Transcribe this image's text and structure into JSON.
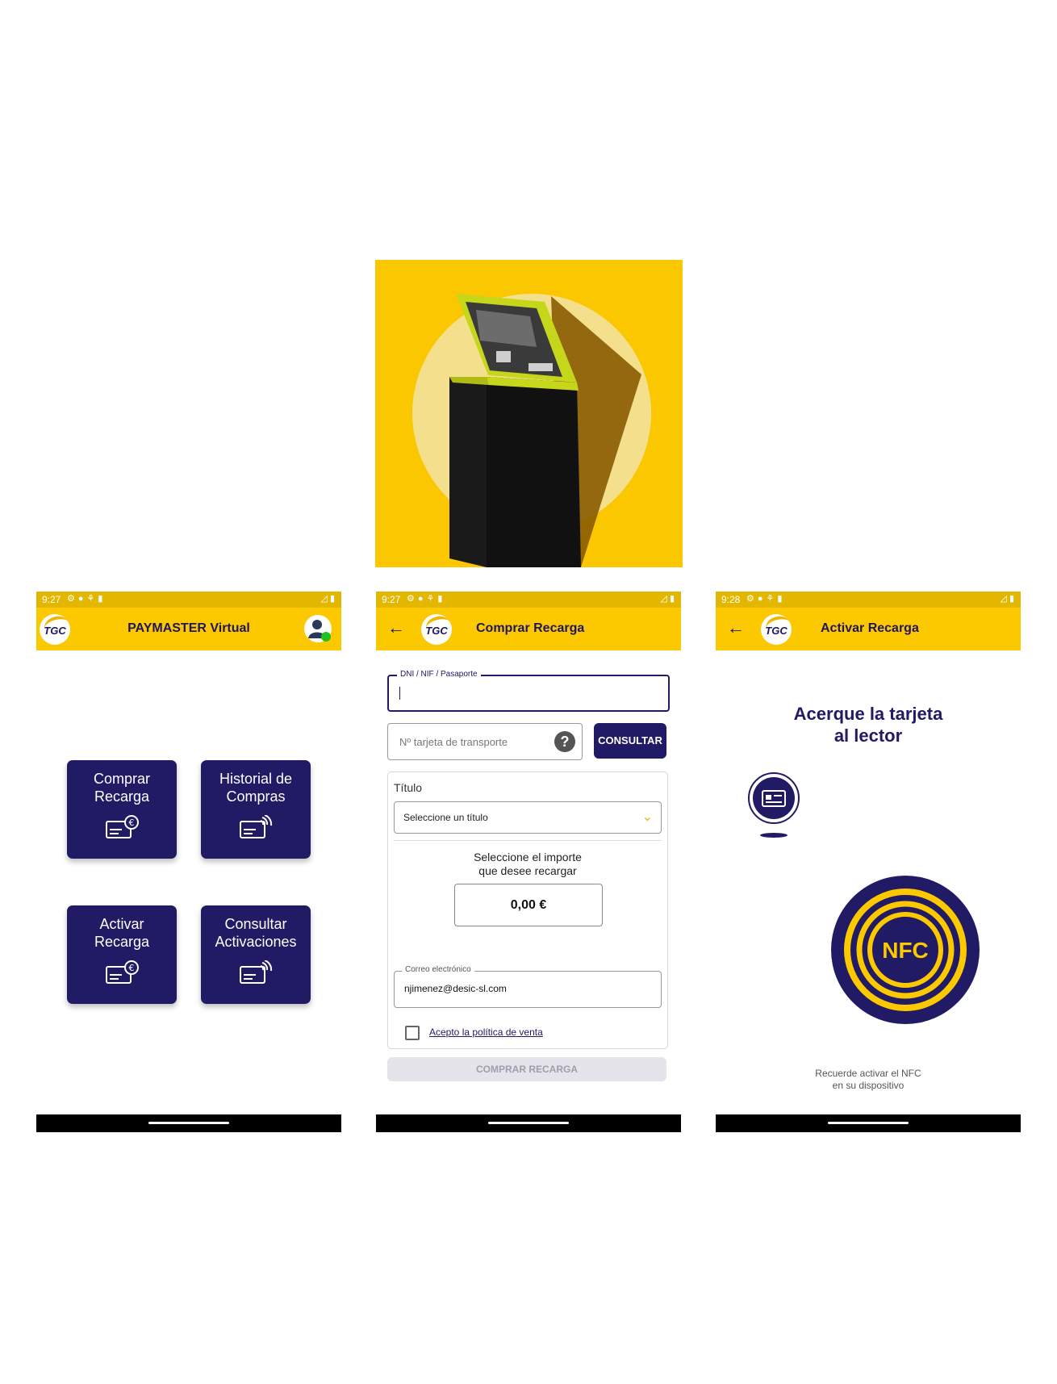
{
  "home": {
    "status": {
      "time": "9:27"
    },
    "appbar": {
      "logo": "TGC",
      "title": "PAYMASTER Virtual",
      "account_icon": "user-account-icon"
    },
    "tiles": [
      {
        "line1": "Comprar",
        "line2": "Recarga",
        "icon": "card-euro-icon"
      },
      {
        "line1": "Historial de",
        "line2": "Compras",
        "icon": "card-contactless-icon"
      },
      {
        "line1": "Activar",
        "line2": "Recarga",
        "icon": "card-euro-icon"
      },
      {
        "line1": "Consultar",
        "line2": "Activaciones",
        "icon": "card-contactless-icon"
      }
    ]
  },
  "buy": {
    "status": {
      "time": "9:27"
    },
    "appbar": {
      "logo": "TGC",
      "title": "Comprar Recarga"
    },
    "dni_label": "DNI / NIF / Pasaporte",
    "dni_value": "",
    "card_placeholder": "Nº tarjeta de transporte",
    "consultar_label": "CONSULTAR",
    "titulo_label": "Título",
    "titulo_select": "Seleccione un título",
    "importe_line1": "Seleccione el importe",
    "importe_line2": "que desee recargar",
    "importe_value": "0,00 €",
    "email_label": "Correo electrónico",
    "email_value": "njimenez@desic-sl.com",
    "policy_label": "Acepto la política de venta",
    "policy_checked": false,
    "submit_label": "COMPRAR RECARGA"
  },
  "activate": {
    "status": {
      "time": "9:28"
    },
    "appbar": {
      "logo": "TGC",
      "title": "Activar Recarga"
    },
    "heading_line1": "Acerque la tarjeta",
    "heading_line2": "al lector",
    "nfc_text": "NFC",
    "hint_line1": "Recuerde activar el NFC",
    "hint_line2": "en su dispositivo"
  },
  "colors": {
    "brand_yellow": "#fcc800",
    "brand_navy": "#211a65",
    "status_yellow": "#e3b700"
  }
}
